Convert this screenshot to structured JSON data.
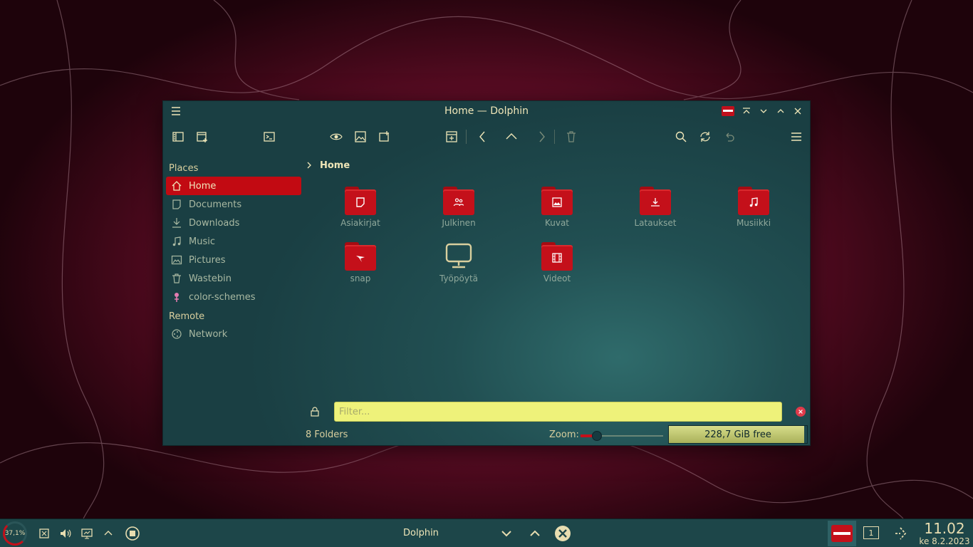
{
  "window": {
    "title": "Home — Dolphin"
  },
  "sidebar": {
    "sections": {
      "places_title": "Places",
      "remote_title": "Remote"
    },
    "places": [
      {
        "label": "Home",
        "icon": "home-icon",
        "active": true
      },
      {
        "label": "Documents",
        "icon": "document-icon"
      },
      {
        "label": "Downloads",
        "icon": "download-icon"
      },
      {
        "label": "Music",
        "icon": "music-icon"
      },
      {
        "label": "Pictures",
        "icon": "picture-icon"
      },
      {
        "label": "Wastebin",
        "icon": "trash-icon"
      },
      {
        "label": "color-schemes",
        "icon": "paint-icon"
      }
    ],
    "remote": [
      {
        "label": "Network",
        "icon": "network-icon"
      }
    ]
  },
  "breadcrumb": {
    "current": "Home"
  },
  "folders": [
    {
      "name": "Asiakirjat",
      "icon": "document-icon"
    },
    {
      "name": "Julkinen",
      "icon": "users-icon"
    },
    {
      "name": "Kuvat",
      "icon": "picture-icon"
    },
    {
      "name": "Lataukset",
      "icon": "download-icon"
    },
    {
      "name": "Musiikki",
      "icon": "music-icon"
    },
    {
      "name": "snap",
      "icon": "snap-icon"
    },
    {
      "name": "Työpöytä",
      "icon": "desktop-icon"
    },
    {
      "name": "Videot",
      "icon": "film-icon"
    }
  ],
  "filter": {
    "placeholder": "Filter...",
    "value": ""
  },
  "status": {
    "folders_count": "8 Folders",
    "zoom_label": "Zoom:",
    "zoom_level": 0.2,
    "free_space": "228,7 GiB free",
    "disk_used_fraction": 0.98
  },
  "taskbar": {
    "cpu_percent": "37,1%",
    "active_task": "Dolphin",
    "desktop_number": "1",
    "clock_time": "11.02",
    "clock_date": "ke 8.2.2023"
  },
  "colors": {
    "accent": "#c20a12",
    "filter_bg": "#eef27a",
    "window_bg": "#214f52",
    "text": "#e8ddb0"
  }
}
